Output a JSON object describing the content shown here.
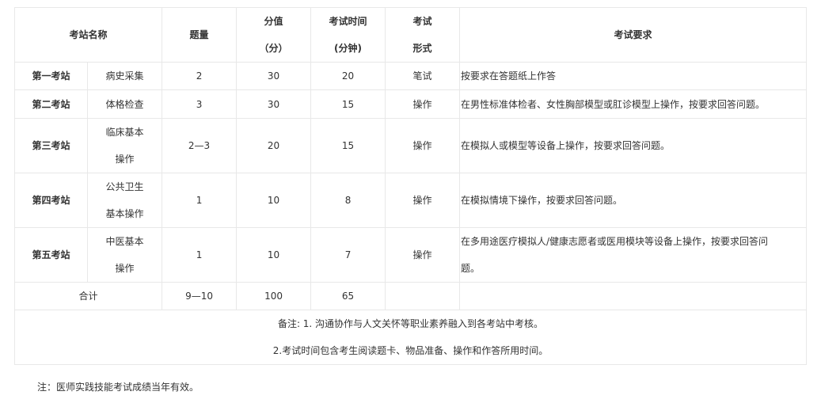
{
  "header": {
    "station_name": "考站名称",
    "question_count": "题量",
    "score_line1": "分值",
    "score_line2": "（分）",
    "time_line1": "考试时间",
    "time_line2": "(分钟)",
    "form_line1": "考试",
    "form_line2": "形式",
    "requirement": "考试要求"
  },
  "rows": [
    {
      "station": "第一考站",
      "name_line1": "病史采集",
      "name_line2": "",
      "count": "2",
      "score": "30",
      "time": "20",
      "form": "笔试",
      "req_line1": "按要求在答题纸上作答",
      "req_line2": ""
    },
    {
      "station": "第二考站",
      "name_line1": "体格检查",
      "name_line2": "",
      "count": "3",
      "score": "30",
      "time": "15",
      "form": "操作",
      "req_line1": "在男性标准体检者、女性胸部模型或肛诊模型上操作，按要求回答问题。",
      "req_line2": ""
    },
    {
      "station": "第三考站",
      "name_line1": "临床基本",
      "name_line2": "操作",
      "count": "2—3",
      "score": "20",
      "time": "15",
      "form": "操作",
      "req_line1": "在模拟人或模型等设备上操作，按要求回答问题。",
      "req_line2": ""
    },
    {
      "station": "第四考站",
      "name_line1": "公共卫生",
      "name_line2": "基本操作",
      "count": "1",
      "score": "10",
      "time": "8",
      "form": "操作",
      "req_line1": "在模拟情境下操作，按要求回答问题。",
      "req_line2": ""
    },
    {
      "station": "第五考站",
      "name_line1": "中医基本",
      "name_line2": "操作",
      "count": "1",
      "score": "10",
      "time": "7",
      "form": "操作",
      "req_line1": "在多用途医疗模拟人/健康志愿者或医用模块等设备上操作，按要求回答问",
      "req_line2": "题。"
    }
  ],
  "total": {
    "label": "合计",
    "count": "9—10",
    "score": "100",
    "time": "65"
  },
  "remarks": {
    "line1": "备注: 1. 沟通协作与人文关怀等职业素养融入到各考站中考核。",
    "line2": "2.考试时间包含考生阅读题卡、物品准备、操作和作答所用时间。"
  },
  "footnote": "注：医师实践技能考试成绩当年有效。"
}
